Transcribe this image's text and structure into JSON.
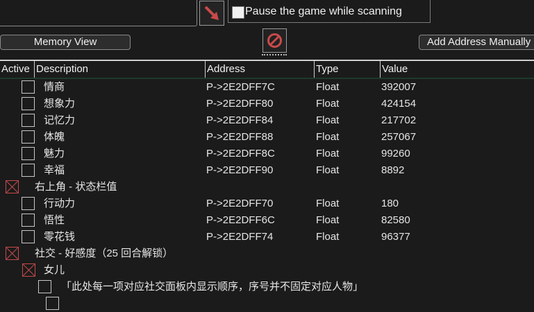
{
  "toolbar": {
    "pause_label": "Pause the game while scanning",
    "memory_view_label": "Memory View",
    "add_address_label": "Add Address Manually",
    "arrow_icon": "red-diagonal-arrow-icon",
    "stop_icon": "no-entry-icon",
    "accent_red": "#c94a4a"
  },
  "table": {
    "headers": {
      "active": "Active",
      "description": "Description",
      "address": "Address",
      "type": "Type",
      "value": "Value"
    },
    "rows": [
      {
        "description": "情商",
        "address": "P->2E2DFF7C",
        "type": "Float",
        "value": "392007",
        "checked": false
      },
      {
        "description": "想象力",
        "address": "P->2E2DFF80",
        "type": "Float",
        "value": "424154",
        "checked": false
      },
      {
        "description": "记忆力",
        "address": "P->2E2DFF84",
        "type": "Float",
        "value": "217702",
        "checked": false
      },
      {
        "description": "体魄",
        "address": "P->2E2DFF88",
        "type": "Float",
        "value": "257067",
        "checked": false
      },
      {
        "description": "魅力",
        "address": "P->2E2DFF8C",
        "type": "Float",
        "value": "99260",
        "checked": false
      },
      {
        "description": "幸福",
        "address": "P->2E2DFF90",
        "type": "Float",
        "value": "8892",
        "checked": false
      },
      {
        "description": "右上角 - 状态栏值",
        "address": "",
        "type": "",
        "value": "",
        "checked": true
      },
      {
        "description": "行动力",
        "address": "P->2E2DFF70",
        "type": "Float",
        "value": "180",
        "checked": false
      },
      {
        "description": "悟性",
        "address": "P->2E2DFF6C",
        "type": "Float",
        "value": "82580",
        "checked": false
      },
      {
        "description": "零花钱",
        "address": "P->2E2DFF74",
        "type": "Float",
        "value": "96377",
        "checked": false
      },
      {
        "description": "社交 - 好感度（25 回合解锁）",
        "address": "",
        "type": "",
        "value": "",
        "checked": true
      },
      {
        "description": "女儿",
        "address": "",
        "type": "",
        "value": "",
        "checked": true
      },
      {
        "description": "「此处每一项对应社交面板内显示顺序，序号并不固定对应人物」",
        "address": "",
        "type": "",
        "value": "",
        "checked": false
      }
    ]
  }
}
